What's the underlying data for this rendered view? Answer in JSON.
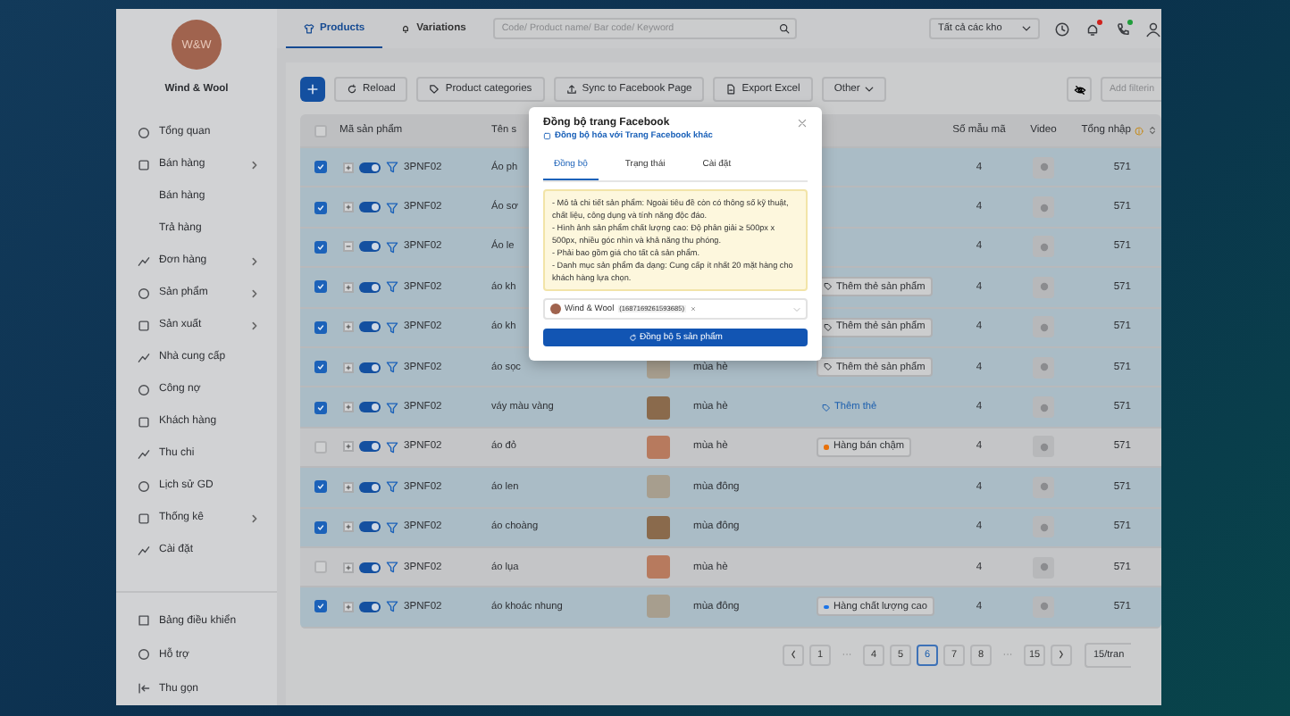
{
  "sidebar": {
    "brand_logo": "W&W",
    "brand_name": "Wind & Wool",
    "items": [
      {
        "label": "Tổng quan",
        "has_submenu": false
      },
      {
        "label": "Bán hàng",
        "has_submenu": true,
        "children": [
          {
            "label": "Bán hàng"
          },
          {
            "label": "Trả hàng"
          }
        ]
      },
      {
        "label": "Đơn hàng",
        "has_submenu": true
      },
      {
        "label": "Sản phẩm",
        "has_submenu": true
      },
      {
        "label": "Sản xuất",
        "has_submenu": true
      },
      {
        "label": "Nhà cung cấp",
        "has_submenu": false
      },
      {
        "label": "Công nợ",
        "has_submenu": false
      },
      {
        "label": "Khách hàng",
        "has_submenu": false
      },
      {
        "label": "Thu chi",
        "has_submenu": false
      },
      {
        "label": "Lịch sử GD",
        "has_submenu": false
      },
      {
        "label": "Thống kê",
        "has_submenu": true
      },
      {
        "label": "Cài đặt",
        "has_submenu": false
      }
    ],
    "bottom_items": [
      {
        "label": "Bảng điều khiển"
      },
      {
        "label": "Hỗ trợ"
      },
      {
        "label": "Thu gọn"
      }
    ]
  },
  "tabs": [
    {
      "label": "Products",
      "selected": true
    },
    {
      "label": "Variations",
      "selected": false
    }
  ],
  "search": {
    "placeholder": "Code/ Product name/ Bar code/ Keyword"
  },
  "warehouse_select": {
    "value": "Tất cả các kho"
  },
  "notifications": {
    "bell_dot": true,
    "phone_dot": true
  },
  "toolbar": {
    "buttons": [
      "Reload",
      "Product categories",
      "Sync to Facebook Page",
      "Export Excel",
      "Other"
    ],
    "filter_placeholder": "Add filterin"
  },
  "table": {
    "select_all": false,
    "columns": [
      "Mã sản phẩm",
      "Tên s",
      "Số mẫu mã",
      "Video",
      "Tổng nhập"
    ],
    "rows": [
      {
        "checked": true,
        "expanded": false,
        "on": true,
        "code": "3PNF02",
        "name": "Áo ph",
        "variants": "4",
        "total": "571"
      },
      {
        "checked": true,
        "expanded": false,
        "on": true,
        "code": "3PNF02",
        "name": "Áo sơ",
        "variants": "4",
        "total": "571"
      },
      {
        "checked": true,
        "expanded": true,
        "on": true,
        "code": "3PNF02",
        "name": "Áo le",
        "variants": "4",
        "total": "571"
      },
      {
        "checked": true,
        "expanded": false,
        "on": true,
        "code": "3PNF02",
        "name": "áo kh",
        "tag": {
          "kind": "chip",
          "label": "Thêm thẻ sản phẩm"
        },
        "variants": "4",
        "total": "571"
      },
      {
        "checked": true,
        "expanded": false,
        "on": true,
        "code": "3PNF02",
        "name": "áo kh",
        "tag": {
          "kind": "chip",
          "label": "Thêm thẻ sản phẩm"
        },
        "variants": "4",
        "total": "571"
      },
      {
        "checked": true,
        "expanded": false,
        "on": true,
        "code": "3PNF02",
        "name": "áo sọc",
        "photo": true,
        "season": "mùa hè",
        "tag": {
          "kind": "chip",
          "label": "Thêm thẻ sản phẩm"
        },
        "variants": "4",
        "total": "571"
      },
      {
        "checked": true,
        "expanded": false,
        "on": true,
        "code": "3PNF02",
        "name": "váy màu vàng",
        "photo": true,
        "season": "mùa hè",
        "tag": {
          "kind": "link",
          "label": "Thêm thẻ"
        },
        "variants": "4",
        "total": "571"
      },
      {
        "checked": false,
        "expanded": false,
        "on": true,
        "code": "3PNF02",
        "name": "áo đỏ",
        "photo": true,
        "season": "mùa hè",
        "tag": {
          "kind": "dot",
          "label": "Hàng bán chậm",
          "color": "#e8710a"
        },
        "variants": "4",
        "total": "571"
      },
      {
        "checked": true,
        "expanded": false,
        "on": true,
        "code": "3PNF02",
        "name": "áo len",
        "photo": true,
        "season": "mùa đông",
        "variants": "4",
        "total": "571"
      },
      {
        "checked": true,
        "expanded": false,
        "on": true,
        "code": "3PNF02",
        "name": "áo choàng",
        "photo": true,
        "season": "mùa đông",
        "variants": "4",
        "total": "571"
      },
      {
        "checked": false,
        "expanded": false,
        "on": true,
        "code": "3PNF02",
        "name": "áo lụa",
        "photo": true,
        "season": "mùa hè",
        "variants": "4",
        "total": "571"
      },
      {
        "checked": true,
        "expanded": false,
        "on": true,
        "code": "3PNF02",
        "name": "áo khoác nhung",
        "photo": true,
        "season": "mùa đông",
        "tag": {
          "kind": "dot",
          "label": "Hàng chất lượng cao",
          "color": "#1a73e8"
        },
        "variants": "4",
        "total": "571"
      }
    ]
  },
  "pagination": {
    "pages": [
      {
        "label": "1",
        "kind": "page",
        "selected": false
      },
      {
        "label": "···",
        "kind": "ellipsis"
      },
      {
        "label": "4",
        "kind": "page",
        "selected": false
      },
      {
        "label": "5",
        "kind": "page",
        "selected": false
      },
      {
        "label": "6",
        "kind": "page",
        "selected": true
      },
      {
        "label": "7",
        "kind": "page",
        "selected": false
      },
      {
        "label": "8",
        "kind": "page",
        "selected": false
      },
      {
        "label": "···",
        "kind": "ellipsis"
      },
      {
        "label": "15",
        "kind": "page",
        "selected": false
      }
    ],
    "page_size": "15/tran"
  },
  "modal": {
    "title": "Đồng bộ trang Facebook",
    "link": "Đồng bộ hóa với Trang Facebook khác",
    "tabs": [
      {
        "label": "Đồng bộ",
        "selected": true
      },
      {
        "label": "Trạng thái",
        "selected": false
      },
      {
        "label": "Cài đặt",
        "selected": false
      }
    ],
    "notes": [
      "- Mô tả chi tiết sản phẩm: Ngoài tiêu đề còn có thông số kỹ thuật, chất liệu, công dụng và tính năng độc đáo.",
      "- Hình ảnh sản phẩm chất lượng cao: Độ phân giải ≥ 500px x 500px, nhiều góc nhìn và khả năng thu phóng.",
      "- Phải bao gồm giá cho tất cả sản phẩm.",
      "- Danh mục sản phẩm đa dạng: Cung cấp ít nhất 20 mặt hàng cho khách hàng lựa chọn."
    ],
    "page_chip": {
      "name": "Wind & Wool",
      "id": "(1687169261593685)"
    },
    "button": "Đồng bộ 5 sản phẩm"
  }
}
